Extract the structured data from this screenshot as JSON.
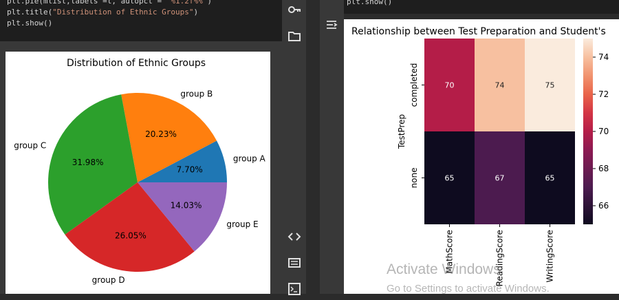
{
  "left_code": {
    "line1_prefix": "plt.pie(mlist,labels =l, autopct = ",
    "line1_str": "%1.2f%%",
    "line1_suffix": ")",
    "line2_prefix": "plt.title(",
    "line2_str": "\"Distribution of Ethnic Groups\"",
    "line2_suffix": ")",
    "line3": "plt.show()"
  },
  "right_code": {
    "line1": "plt.show()"
  },
  "rail_icons": [
    "key-icon",
    "folder-icon",
    "code-icon",
    "terminal-list-icon",
    "terminal-icon"
  ],
  "right_side_icon": "output-icon",
  "chart_data": [
    {
      "type": "pie",
      "title": "Distribution of Ethnic Groups",
      "categories": [
        "group A",
        "group B",
        "group C",
        "group D",
        "group E"
      ],
      "values": [
        7.7,
        20.23,
        31.98,
        26.05,
        14.03
      ],
      "labels_pct": [
        "7.70%",
        "20.23%",
        "31.98%",
        "26.05%",
        "14.03%"
      ],
      "colors": [
        "#1f77b4",
        "#ff7f0e",
        "#2ca02c",
        "#d62728",
        "#9467bd"
      ]
    },
    {
      "type": "heatmap",
      "title": "Relationship between Test Preparation and Student's",
      "ylabel": "TestPrep",
      "rows": [
        "completed",
        "none"
      ],
      "columns": [
        "MathScore",
        "ReadingScore",
        "WritingScore"
      ],
      "values": [
        [
          70,
          74,
          75
        ],
        [
          65,
          67,
          65
        ]
      ],
      "colorbar_ticks": [
        66,
        68,
        70,
        72,
        74
      ],
      "colorbar_range": [
        65,
        75
      ]
    }
  ],
  "watermark": {
    "line1": "Activate Windows",
    "line2": "Go to Settings to activate Windows."
  }
}
